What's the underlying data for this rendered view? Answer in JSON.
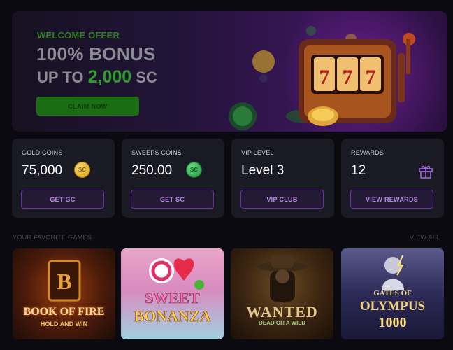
{
  "banner": {
    "kicker": "WELCOME OFFER",
    "title": "100% BONUS",
    "sub_prefix": "UP TO",
    "sub_amount": "2,000",
    "sub_suffix": "SC",
    "claim_label": "CLAIM NOW",
    "art_reels": "777"
  },
  "cards": [
    {
      "label": "GOLD COINS",
      "value": "75,000",
      "icon": "gold-coin-icon",
      "icon_text": "SC",
      "button": "GET GC"
    },
    {
      "label": "SWEEPS COINS",
      "value": "250.00",
      "icon": "sweeps-coin-icon",
      "icon_text": "SC",
      "button": "GET SC"
    },
    {
      "label": "VIP LEVEL",
      "value": "Level 3",
      "button": "VIP CLUB"
    },
    {
      "label": "REWARDS",
      "value": "12",
      "icon": "gift-icon",
      "button": "VIEW REWARDS"
    }
  ],
  "games_section": {
    "title": "YOUR FAVORITE GAMES",
    "view_all": "VIEW ALL",
    "games": [
      {
        "title": "BOOK OF FIRE",
        "subtitle": "HOLD AND WIN"
      },
      {
        "title": "SWEET",
        "subtitle": "BONANZA"
      },
      {
        "title": "WANTED",
        "subtitle": "DEAD OR A WILD"
      },
      {
        "title": "GATES OF",
        "subtitle": "OLYMPUS",
        "extra": "1000"
      }
    ]
  },
  "colors": {
    "background": "#0b0a11",
    "card": "#1a1a24",
    "accent_purple": "#6c2fa8",
    "offer_green": "#2c9c2a"
  }
}
